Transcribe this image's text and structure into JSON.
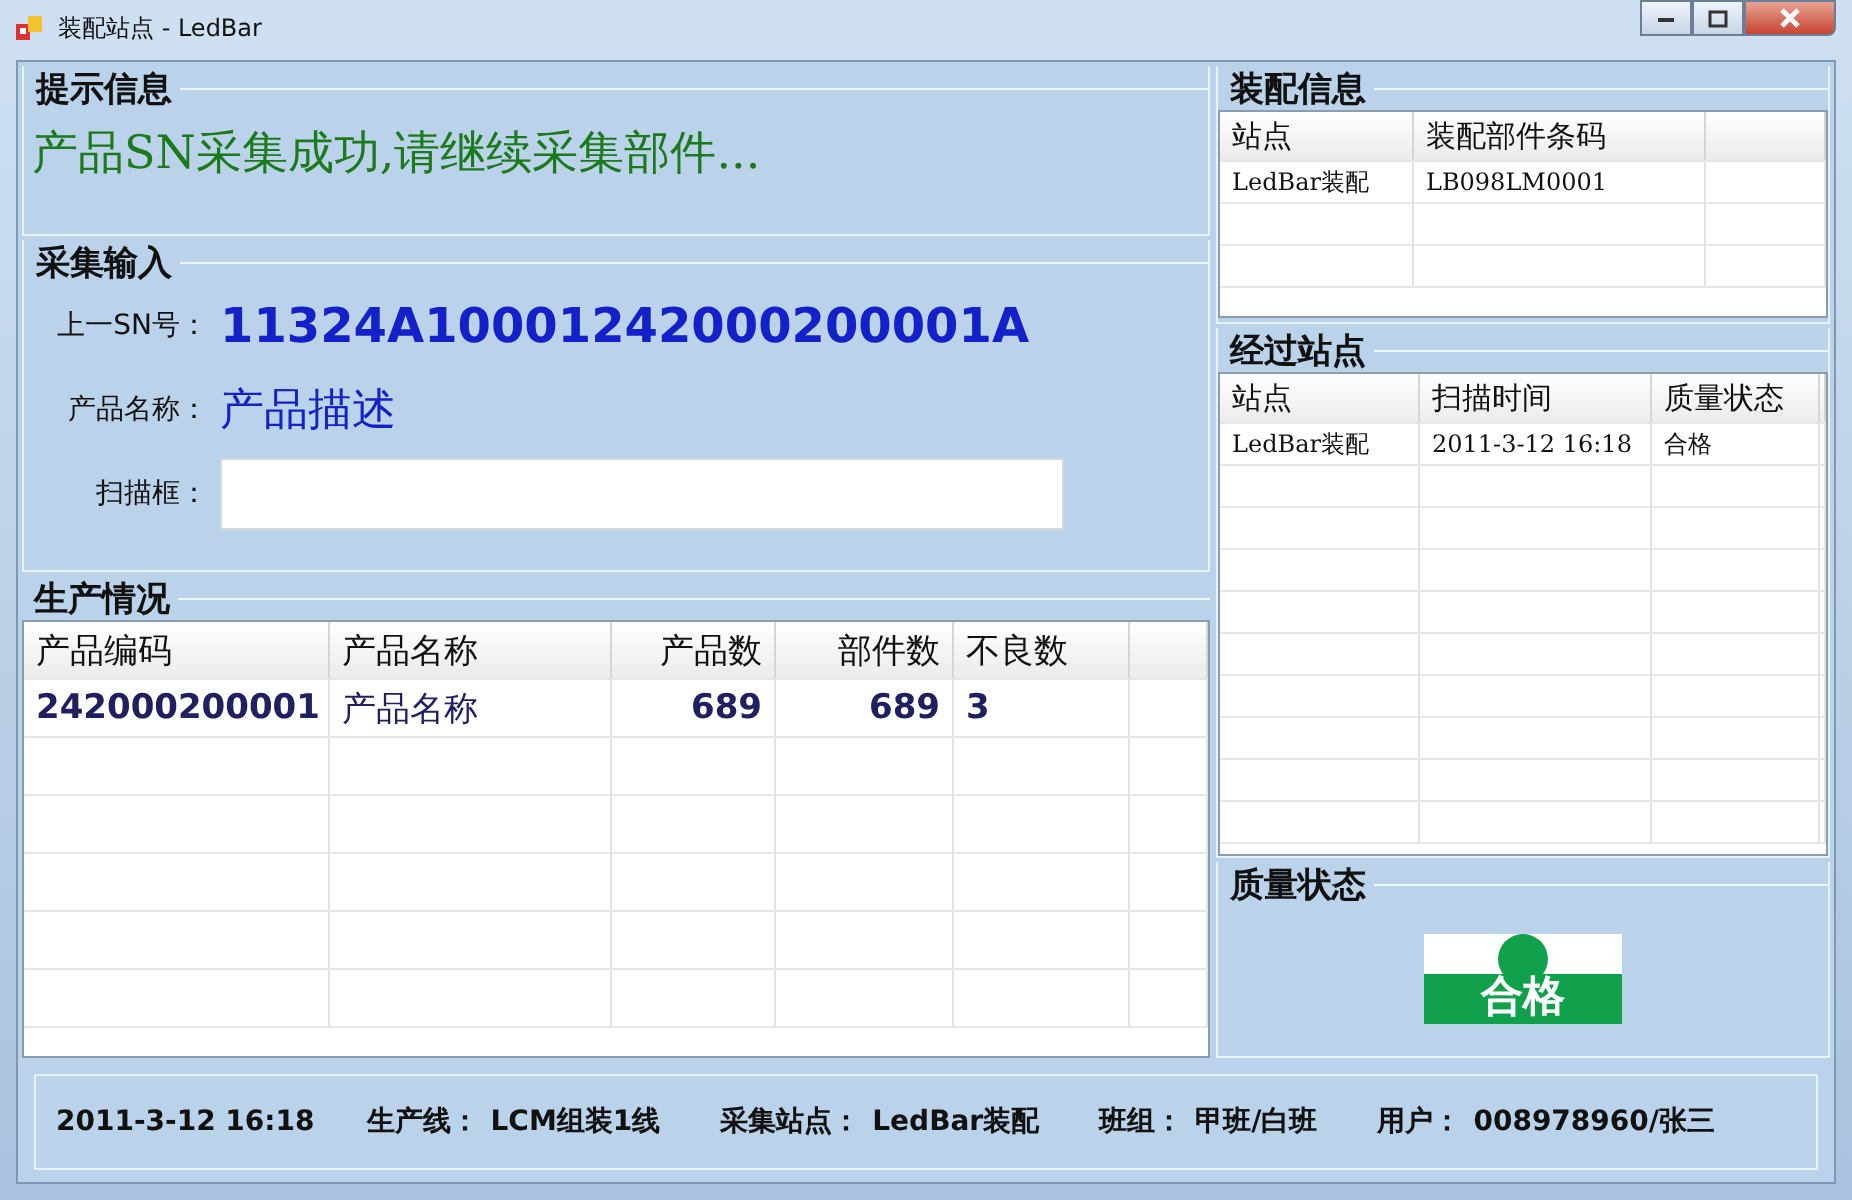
{
  "window": {
    "title": "装配站点 - LedBar"
  },
  "prompt_info": {
    "title": "提示信息",
    "message": "产品SN采集成功,请继续采集部件..."
  },
  "input": {
    "title": "采集输入",
    "fields": [
      {
        "kind": "sn",
        "label": "上一SN号：",
        "value": "11324A10001242000200001A"
      },
      {
        "kind": "name",
        "label": "产品名称：",
        "value": "产品描述"
      },
      {
        "kind": "scan",
        "label": "扫描框："
      }
    ]
  },
  "production": {
    "title": "生产情况",
    "columns": [
      {
        "label": "产品编码",
        "kind": "text"
      },
      {
        "label": "产品名称",
        "kind": "text"
      },
      {
        "label": "产品数",
        "kind": "number"
      },
      {
        "label": "部件数",
        "kind": "number"
      },
      {
        "label": "不良数",
        "kind": "text"
      }
    ],
    "rows": [
      [
        "242000200001",
        "产品名称",
        "689",
        "689",
        "3"
      ]
    ]
  },
  "assembly": {
    "title": "装配信息",
    "columns": [
      "站点",
      "装配部件条码"
    ],
    "rows": [
      [
        "LedBar装配",
        "LB098LM0001"
      ]
    ]
  },
  "stations": {
    "title": "经过站点",
    "columns": [
      "站点",
      "扫描时间",
      "质量状态"
    ],
    "rows": [
      [
        "LedBar装配",
        "2011-3-12 16:18",
        "合格"
      ]
    ]
  },
  "quality": {
    "title": "质量状态",
    "status": "合格"
  },
  "status_bar": {
    "datetime": "2011-3-12 16:18",
    "items": [
      {
        "label": "生产线：",
        "value": "LCM组装1线"
      },
      {
        "label": "采集站点：",
        "value": "LedBar装配"
      },
      {
        "label": "班组：",
        "value": "甲班/白班"
      },
      {
        "label": "用户：",
        "value": "008978960/张三"
      }
    ]
  }
}
